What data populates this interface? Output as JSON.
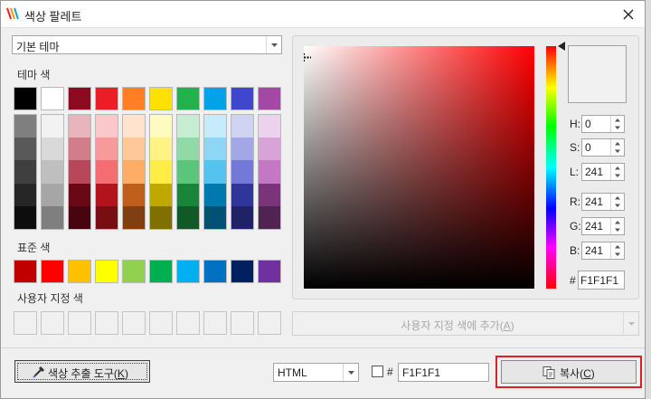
{
  "window": {
    "title": "색상 팔레트",
    "icon": "app-logo-icon",
    "close_icon": "close-icon"
  },
  "theme_dropdown": {
    "value": "기본 테마",
    "icon": "chevron-down-icon"
  },
  "labels": {
    "theme_colors": "테마 색",
    "standard_colors": "표준 색",
    "custom_colors": "사용자 지정 색"
  },
  "theme_colors": {
    "base": [
      "#000000",
      "#ffffff",
      "#8b0a1e",
      "#ee1c25",
      "#ff7f27",
      "#ffe100",
      "#22b14c",
      "#00a2e8",
      "#3f48cc",
      "#a349a4"
    ],
    "shades": [
      [
        "#7f7f7f",
        "#595959",
        "#3f3f3f",
        "#262626",
        "#0d0d0d"
      ],
      [
        "#f2f2f2",
        "#d9d9d9",
        "#bfbfbf",
        "#a6a6a6",
        "#7f7f7f"
      ],
      [
        "#e8b5bd",
        "#d27d8a",
        "#b9475b",
        "#6a0816",
        "#470510"
      ],
      [
        "#fbc8c9",
        "#f79a9c",
        "#f36d71",
        "#b3141b",
        "#780d12"
      ],
      [
        "#ffe3cc",
        "#ffc899",
        "#ffac66",
        "#bf5f1d",
        "#803f13"
      ],
      [
        "#fff9c2",
        "#fff385",
        "#ffed47",
        "#bfa800",
        "#807000"
      ],
      [
        "#c6ecd1",
        "#91d9a6",
        "#5bc679",
        "#198539",
        "#115926"
      ],
      [
        "#c6ebfa",
        "#8dd7f5",
        "#54c3f0",
        "#0079ae",
        "#005174"
      ],
      [
        "#d0d2f2",
        "#a3a7e6",
        "#7479d9",
        "#2f3599",
        "#1f2366"
      ],
      [
        "#ecd2ec",
        "#d8a4d8",
        "#c477c4",
        "#7a357a",
        "#512351"
      ]
    ]
  },
  "standard_colors": [
    "#c00000",
    "#ff0000",
    "#ffc000",
    "#ffff00",
    "#92d050",
    "#00b050",
    "#00b0f0",
    "#0070c0",
    "#002060",
    "#7030a0"
  ],
  "custom_slots": 10,
  "picker": {
    "fields": [
      {
        "label": "H:",
        "value": "0"
      },
      {
        "label": "S:",
        "value": "0"
      },
      {
        "label": "L:",
        "value": "241"
      },
      {
        "label": "R:",
        "value": "241"
      },
      {
        "label": "G:",
        "value": "241"
      },
      {
        "label": "B:",
        "value": "241"
      }
    ],
    "hash": "#",
    "hex": "F1F1F1",
    "preview_color": "#f1f1f1",
    "hue_color": "#ff0000"
  },
  "add_custom_button": {
    "label": "사용자 지정 색에 추가",
    "key": "A"
  },
  "footer": {
    "eyedropper_label": "색상 추출 도구",
    "eyedropper_key": "K",
    "eyedropper_icon": "eyedropper-icon",
    "format_value": "HTML",
    "hash_label": "#",
    "hex_value": "F1F1F1",
    "copy_label": "복사",
    "copy_key": "C",
    "copy_icon": "copy-icon",
    "highlight_color": "#e02020"
  }
}
